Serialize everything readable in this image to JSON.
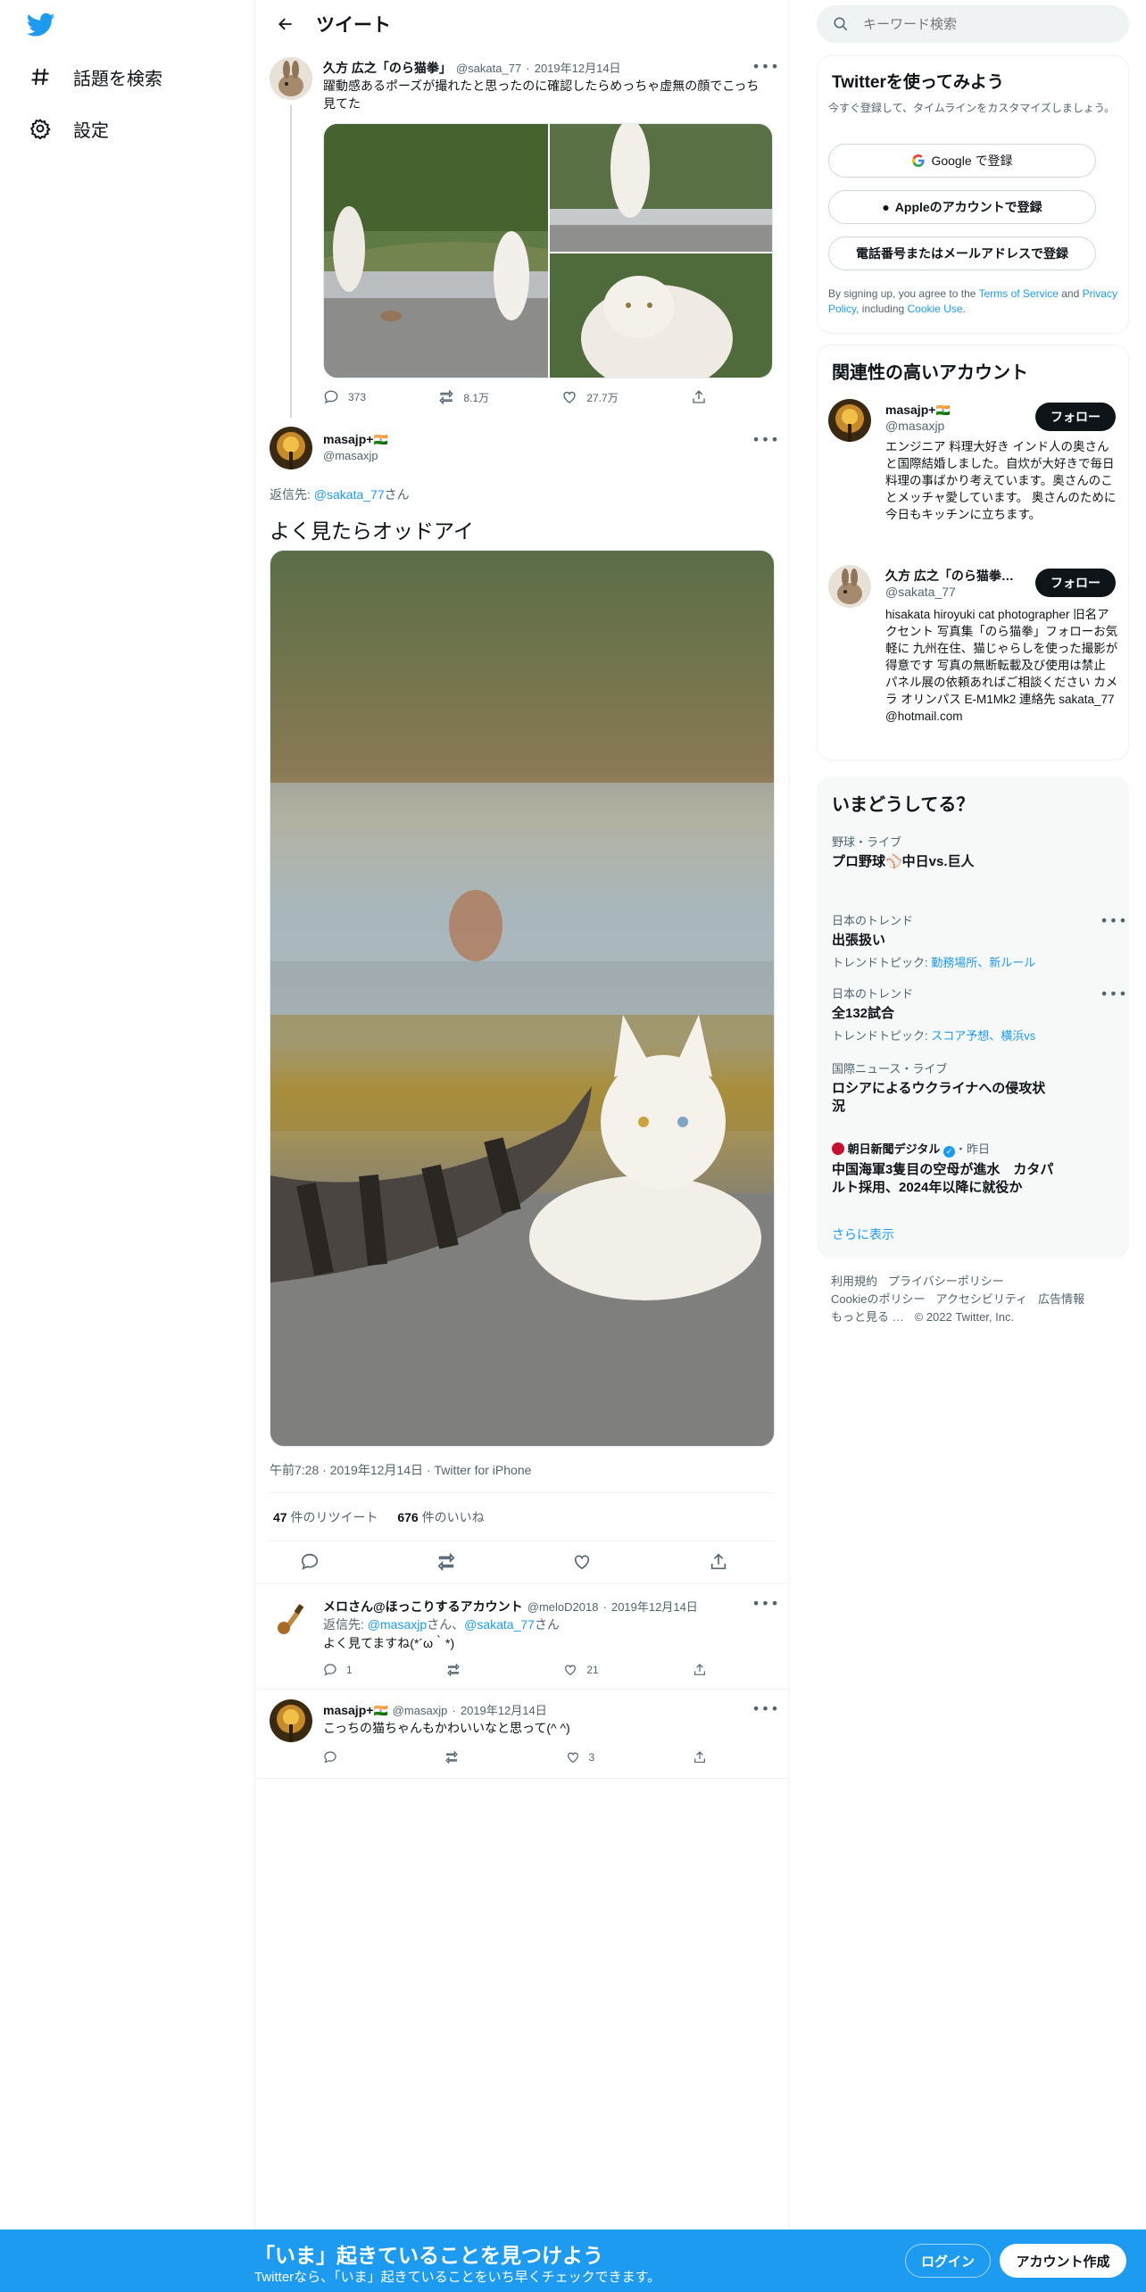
{
  "nav": {
    "explore_label": "話題を検索",
    "settings_label": "設定"
  },
  "header": {
    "title": "ツイート"
  },
  "parent_tweet": {
    "name": "久方 広之「のら猫拳」",
    "handle": "@sakata_77",
    "date": "2019年12月14日",
    "text": "躍動感あるポーズが撮れたと思ったのに確認したらめっちゃ虚無の顔でこっち見てた",
    "replies": "373",
    "retweets": "8.1万",
    "likes": "27.7万"
  },
  "main_tweet": {
    "name": "masajp+",
    "flag": "🇮🇳",
    "handle": "@masaxjp",
    "reply_to_prefix": "返信先: ",
    "reply_to_handle": "@sakata_77",
    "reply_to_suffix": "さん",
    "text": "よく見たらオッドアイ",
    "time": "午前7:28",
    "date": "2019年12月14日",
    "client": "Twitter for iPhone",
    "retweet_count": "47",
    "retweet_label": "件のリツイート",
    "like_count": "676",
    "like_label": "件のいいね"
  },
  "replies": [
    {
      "name": "メロさん@ほっこりするアカウント",
      "handle": "@meloD2018",
      "date": "2019年12月14日",
      "reply_to_prefix": "返信先: ",
      "reply_to_h1": "@masaxjp",
      "reply_to_mid": "さん、",
      "reply_to_h2": "@sakata_77",
      "reply_to_suffix": "さん",
      "text": "よく見てますね(*´ω｀*)",
      "replies": "1",
      "retweets": "",
      "likes": "21"
    },
    {
      "name": "masajp+",
      "flag": "🇮🇳",
      "handle": "@masaxjp",
      "date": "2019年12月14日",
      "text": "こっちの猫ちゃんもかわいいなと思って(^ ^)",
      "replies": "",
      "retweets": "",
      "likes": "3"
    }
  ],
  "search": {
    "placeholder": "キーワード検索"
  },
  "signup": {
    "title": "Twitterを使ってみよう",
    "subtitle": "今すぐ登録して、タイムラインをカスタマイズしましょう。",
    "google": "Google で登録",
    "apple": "Appleのアカウントで登録",
    "phone": "電話番号またはメールアドレスで登録",
    "terms_prefix": "By signing up, you agree to the ",
    "terms_link": "Terms of Service",
    "terms_and": " and ",
    "privacy_link": "Privacy Policy",
    "terms_including": ", including ",
    "cookie_link": "Cookie Use",
    "terms_end": "."
  },
  "related": {
    "title": "関連性の高いアカウント",
    "follow_label": "フォロー",
    "accounts": [
      {
        "name": "masajp+",
        "flag": "🇮🇳",
        "handle": "@masaxjp",
        "bio": "エンジニア 料理大好き インド人の奥さんと国際結婚しました。自炊が大好きで毎日料理の事ばかり考えています。奥さんのことメッチャ愛しています。 奥さんのために今日もキッチンに立ちます。"
      },
      {
        "name": "久方 広之「のら猫拳…",
        "handle": "@sakata_77",
        "bio": "hisakata hiroyuki cat photographer 旧名アクセント 写真集「のら猫拳」フォローお気軽に 九州在住、猫じゃらしを使った撮影が得意です 写真の無断転載及び使用は禁止 パネル展の依頼あればご相談ください カメラ オリンパス E-M1Mk2 連絡先 sakata_77@hotmail.com"
      }
    ]
  },
  "trends": {
    "title": "いまどうしてる？",
    "items": [
      {
        "category": "野球・ライブ",
        "name": "プロ野球⚾中日vs.巨人",
        "sub_prefix": "",
        "sub_links": ""
      },
      {
        "category": "日本のトレンド",
        "name": "出張扱い",
        "sub_prefix": "トレンドトピック: ",
        "sub_links": "勤務場所、新ルール"
      },
      {
        "category": "日本のトレンド",
        "name": "全132試合",
        "sub_prefix": "トレンドトピック: ",
        "sub_links": "スコア予想、横浜vs"
      },
      {
        "category": "国際ニュース・ライブ",
        "name": "ロシアによるウクライナへの侵攻状況",
        "sub_prefix": "",
        "sub_links": ""
      },
      {
        "category": "朝日新聞デジタル",
        "category_suffix": "・昨日",
        "name": "中国海軍3隻目の空母が進水　カタパルト採用、2024年以降に就役か",
        "sub_prefix": "",
        "sub_links": ""
      }
    ],
    "show_more": "さらに表示"
  },
  "footer": {
    "links": [
      "利用規約",
      "プライバシーポリシー",
      "Cookieのポリシー",
      "アクセシビリティ",
      "広告情報",
      "もっと見る …",
      "© 2022 Twitter, Inc."
    ]
  },
  "bottom_bar": {
    "title": "「いま」起きていることを見つけよう",
    "subtitle": "Twitterなら、「いま」起きていることをいち早くチェックできます。",
    "login": "ログイン",
    "signup": "アカウント作成"
  },
  "colors": {
    "accent": "#1d9bf0",
    "text": "#0f1419",
    "muted": "#536471"
  }
}
